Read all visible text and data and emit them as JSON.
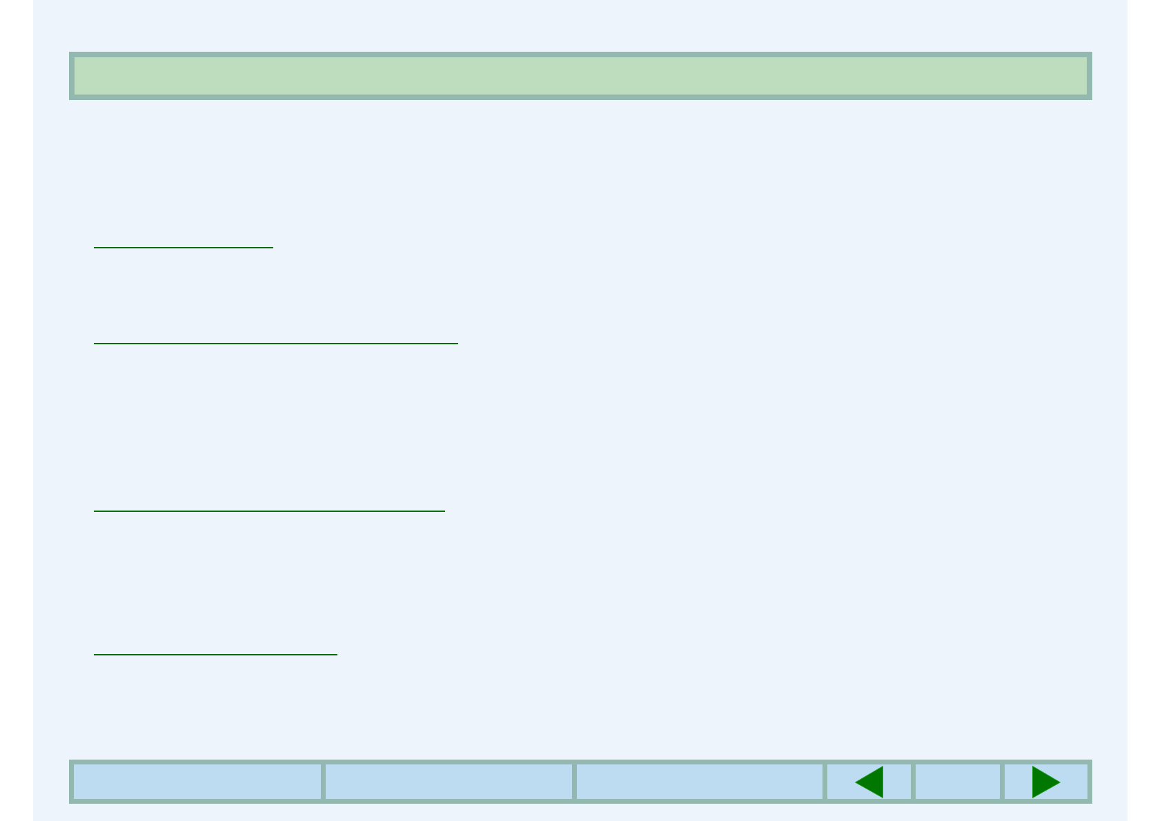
{
  "links": [
    {
      "kind": "link"
    },
    {
      "kind": "link"
    },
    {
      "kind": "link"
    },
    {
      "kind": "link"
    }
  ],
  "nav_bar": {
    "cells": [
      {
        "kind": "blank"
      },
      {
        "kind": "blank"
      },
      {
        "kind": "blank"
      },
      {
        "kind": "previous"
      },
      {
        "kind": "blank"
      },
      {
        "kind": "next"
      }
    ]
  }
}
